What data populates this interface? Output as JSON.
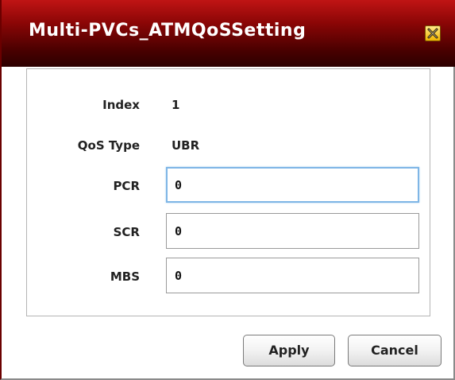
{
  "dialog": {
    "title": "Multi-PVCs_ATMQoSSetting",
    "close_icon": "close-icon",
    "accent_color": "#8a0606"
  },
  "form": {
    "index": {
      "label": "Index",
      "value": "1"
    },
    "qos_type": {
      "label": "QoS Type",
      "value": "UBR"
    },
    "pcr": {
      "label": "PCR",
      "value": "0"
    },
    "scr": {
      "label": "SCR",
      "value": "0"
    },
    "mbs": {
      "label": "MBS",
      "value": "0"
    }
  },
  "buttons": {
    "apply_label": "Apply",
    "cancel_label": "Cancel"
  }
}
